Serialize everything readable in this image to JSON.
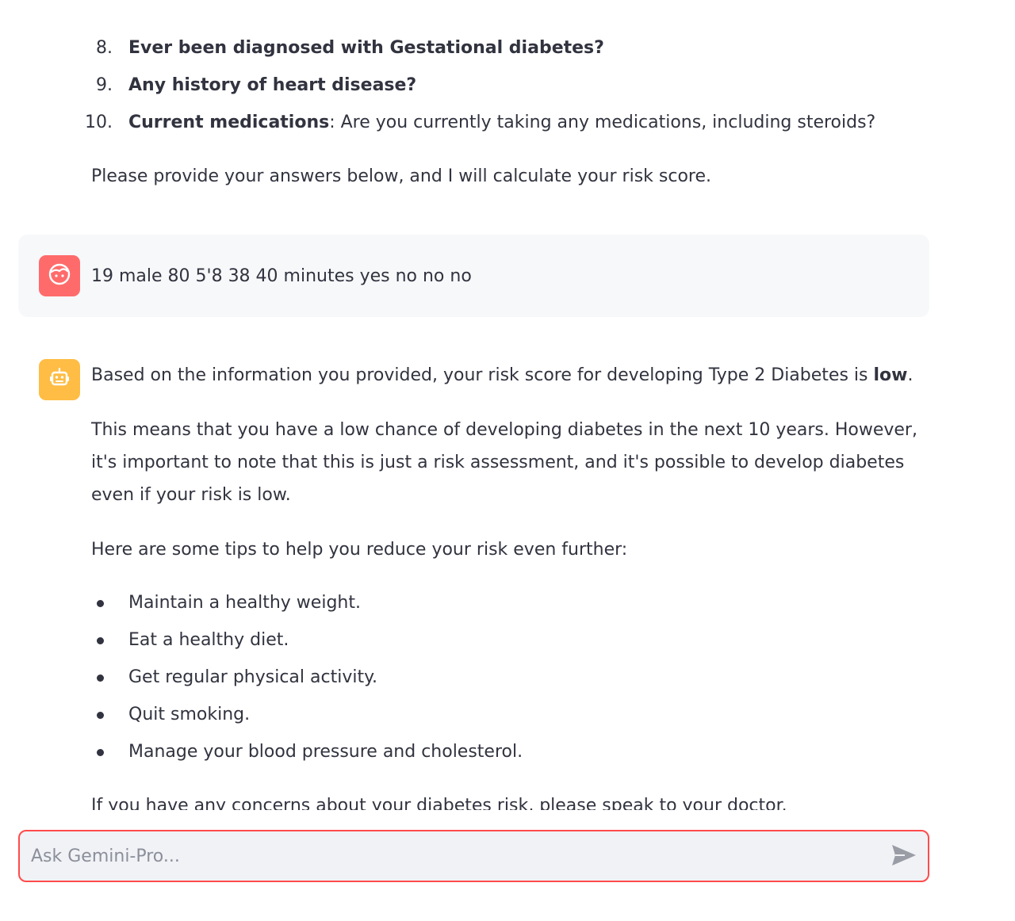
{
  "assistant_prev": {
    "numbered_items": [
      {
        "num": "8.",
        "bold": "Ever been diagnosed with Gestational diabetes?",
        "rest": ""
      },
      {
        "num": "9.",
        "bold": "Any history of heart disease?",
        "rest": ""
      },
      {
        "num": "10.",
        "bold": "Current medications",
        "rest": ": Are you currently taking any medications, including steroids?"
      }
    ],
    "closing": "Please provide your answers below, and I will calculate your risk score."
  },
  "user_message": {
    "avatar_icon": "user-face-icon",
    "text": "19 male 80 5'8 38 40 minutes yes no no no"
  },
  "assistant_message": {
    "avatar_icon": "robot-icon",
    "p1_before": "Based on the information you provided, your risk score for developing Type 2 Diabetes is ",
    "p1_bold": "low",
    "p1_after": ".",
    "p2": "This means that you have a low chance of developing diabetes in the next 10 years. However, it's important to note that this is just a risk assessment, and it's possible to develop diabetes even if your risk is low.",
    "p3": "Here are some tips to help you reduce your risk even further:",
    "tips": [
      "Maintain a healthy weight.",
      "Eat a healthy diet.",
      "Get regular physical activity.",
      "Quit smoking.",
      "Manage your blood pressure and cholesterol."
    ],
    "p4": "If you have any concerns about your diabetes risk, please speak to your doctor."
  },
  "chat_input": {
    "placeholder": "Ask Gemini-Pro...",
    "value": "",
    "send_icon": "send-icon"
  },
  "colors": {
    "accent": "#ff4b4b",
    "user_avatar": "#ff6b6b",
    "bot_avatar": "#ffbd45",
    "text": "#31333f"
  }
}
